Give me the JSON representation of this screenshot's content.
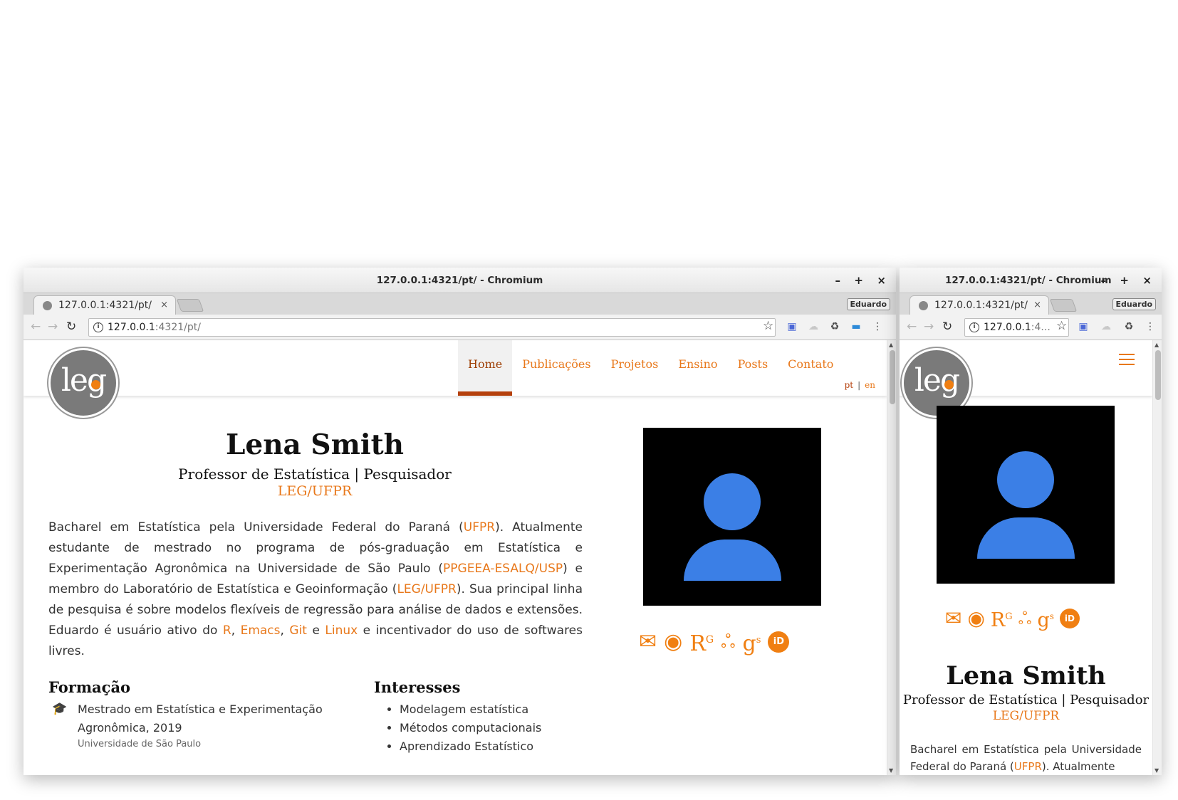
{
  "window_title": "127.0.0.1:4321/pt/ - Chromium",
  "window_controls": {
    "minimize": "–",
    "maximize": "+",
    "close": "×"
  },
  "tab": {
    "title": "127.0.0.1:4321/pt/",
    "close": "×"
  },
  "profile_label": "Eduardo",
  "address": {
    "host": "127.0.0.1",
    "rest": ":4321/pt/",
    "narrow_rest": ":4..."
  },
  "nav": {
    "items": [
      "Home",
      "Publicações",
      "Projetos",
      "Ensino",
      "Posts",
      "Contato"
    ],
    "active": "Home",
    "lang": {
      "pt": "pt",
      "sep": "|",
      "en": "en"
    }
  },
  "logo_text": {
    "a": "le",
    "b": "g"
  },
  "profile": {
    "name": "Lena Smith",
    "title": "Professor de Estatística | Pesquisador",
    "affiliation": "LEG/UFPR"
  },
  "bio": {
    "p1": "Bacharel em Estatística pela Universidade Federal do Paraná (",
    "l1": "UFPR",
    "p2": "). Atualmente estudante de mestrado no programa de pós-graduação em Estatística e Experimentação Agronômica na Universidade de São Paulo (",
    "l2": "PPGEEA-ESALQ/USP",
    "p3": ") e membro do Laboratório de Estatística e Geoinformação (",
    "l3": "LEG/UFPR",
    "p4": "). Sua principal linha de pesquisa é sobre modelos flexíveis de regressão para análise de dados e extensões. Eduardo é usuário ativo do ",
    "l4": "R",
    "p5": ", ",
    "l5": "Emacs",
    "p6": ", ",
    "l6": "Git",
    "p7": " e ",
    "l7": "Linux",
    "p8": " e incentivador do uso de softwares livres.",
    "narrow_p1": "Bacharel em Estatística pela Universidade Federal do Paraná (",
    "narrow_l1": "UFPR",
    "narrow_p2": "). Atualmente"
  },
  "social_icons": [
    "envelope-icon",
    "github-icon",
    "researchgate-icon",
    "mendeley-icon",
    "google-scholar-icon",
    "orcid-icon"
  ],
  "social_glyphs": {
    "rg": "R",
    "rg_sup": "G",
    "gs": "g",
    "gs_sup": "s",
    "orcid": "iD",
    "github": "◉",
    "mendeley": "ஃ"
  },
  "formacao": {
    "heading": "Formação",
    "items": [
      {
        "degree": "Mestrado em Estatística e Experimentação Agronômica, 2019",
        "institution": "Universidade de São Paulo"
      }
    ]
  },
  "interesses": {
    "heading": "Interesses",
    "items": [
      "Modelagem estatística",
      "Métodos computacionais",
      "Aprendizado Estatístico"
    ]
  },
  "colors": {
    "accent": "#e8781b",
    "active_nav": "#b5400c",
    "avatar_bg": "#000000",
    "avatar_fg": "#3b7fe6"
  }
}
